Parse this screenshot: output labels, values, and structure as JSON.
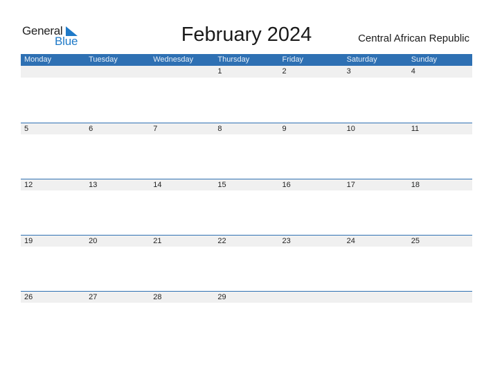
{
  "logo": {
    "line1": "General",
    "line2": "Blue"
  },
  "title": "February 2024",
  "country": "Central African Republic",
  "colors": {
    "accent": "#2e70b3",
    "logo_blue": "#1f7ac8",
    "date_band": "#f0f0f0"
  },
  "weekdays": [
    "Monday",
    "Tuesday",
    "Wednesday",
    "Thursday",
    "Friday",
    "Saturday",
    "Sunday"
  ],
  "weeks": [
    [
      "",
      "",
      "",
      "1",
      "2",
      "3",
      "4"
    ],
    [
      "5",
      "6",
      "7",
      "8",
      "9",
      "10",
      "11"
    ],
    [
      "12",
      "13",
      "14",
      "15",
      "16",
      "17",
      "18"
    ],
    [
      "19",
      "20",
      "21",
      "22",
      "23",
      "24",
      "25"
    ],
    [
      "26",
      "27",
      "28",
      "29",
      "",
      "",
      ""
    ]
  ]
}
